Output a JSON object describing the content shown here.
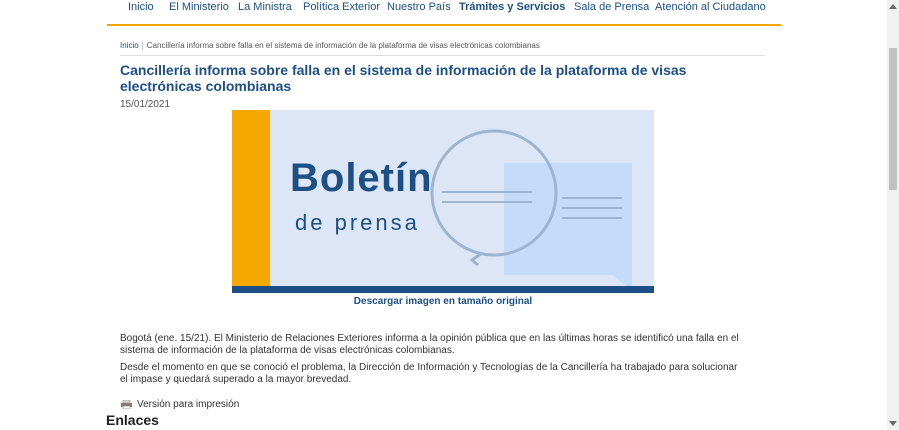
{
  "nav": {
    "items": [
      {
        "label": "Inicio"
      },
      {
        "label": "El Ministerio"
      },
      {
        "label": "La Ministra"
      },
      {
        "label": "Política Exterior"
      },
      {
        "label": "Nuestro País"
      },
      {
        "label": "Trámites y Servicios"
      },
      {
        "label": "Sala de Prensa"
      },
      {
        "label": "Atención al Ciudadano"
      }
    ],
    "active_index": 5
  },
  "breadcrumb": {
    "home": "Inicio",
    "separator": "|",
    "current": "Cancillería informa sobre falla en el sistema de información de la plataforma de visas electrónicas colombianas"
  },
  "article": {
    "title": "Cancillería informa sobre falla en el sistema de información de la plataforma de visas electrónicas colombianas",
    "date": "15/01/2021",
    "banner": {
      "title": "Boletín",
      "subtitle": "de prensa"
    },
    "download_label": "Descargar imagen en tamaño original",
    "paragraphs": [
      "Bogotá (ene. 15/21). El Ministerio de Relaciones Exteriores informa a la opinión pública que en las últimas horas se identificó una falla en el sistema de información de la plataforma de visas electrónicas colombianas.",
      "Desde el momento en que se conoció el problema, la Dirección de Información y Tecnologías de la Cancillería ha trabajado para solucionar el impase y quedará superado a la mayor brevedad."
    ],
    "print_label": "Versión para impresión",
    "links_heading": "Enlaces"
  },
  "colors": {
    "brand_blue": "#1c4f86",
    "accent_orange": "#f5a800",
    "banner_bg": "#dde6f6"
  },
  "icons": {
    "print": "printer-icon"
  }
}
